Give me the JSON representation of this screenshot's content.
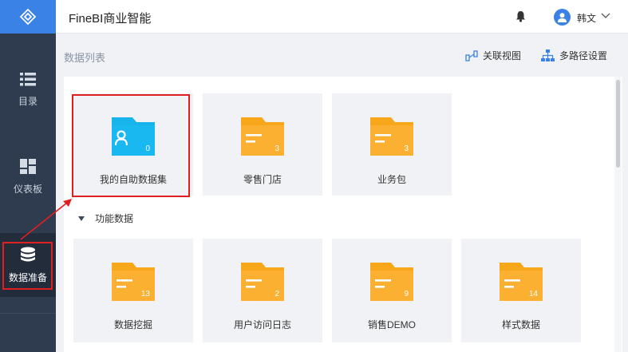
{
  "app": {
    "title": "FineBI商业智能"
  },
  "header": {
    "user_name": "韩文"
  },
  "sidebar": {
    "items": [
      {
        "label": "目录"
      },
      {
        "label": "仪表板"
      },
      {
        "label": "数据准备"
      }
    ]
  },
  "toolbar": {
    "page_title": "数据列表",
    "relation_view_label": "关联视图",
    "multipath_label": "多路径设置"
  },
  "folders_top": [
    {
      "name": "我的自助数据集",
      "count": "0",
      "color": "#17b4ec"
    },
    {
      "name": "零售门店",
      "count": "3",
      "color": "#f8a71b"
    },
    {
      "name": "业务包",
      "count": "3",
      "color": "#f8a71b"
    }
  ],
  "section": {
    "label": "功能数据"
  },
  "folders_bottom": [
    {
      "name": "数据挖掘",
      "count": "13",
      "color": "#f8a71b"
    },
    {
      "name": "用户访问日志",
      "count": "2",
      "color": "#f8a71b"
    },
    {
      "name": "销售DEMO",
      "count": "9",
      "color": "#f8a71b"
    },
    {
      "name": "样式数据",
      "count": "14",
      "color": "#f8a71b"
    }
  ],
  "colors": {
    "accent": "#3b82e6",
    "sidebar": "#2f3b4e",
    "highlight": "#e02020"
  }
}
